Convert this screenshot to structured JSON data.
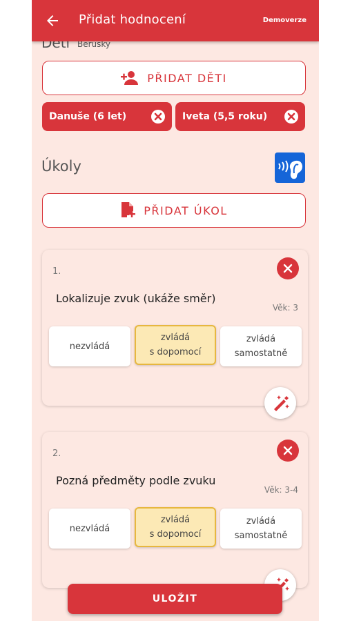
{
  "header": {
    "title": "Přidat hodnocení",
    "demo_label": "Demoverze"
  },
  "children_section": {
    "label": "Děti",
    "group": "Berušky",
    "add_button": "PŘIDAT DĚTI",
    "chips": [
      {
        "label": "Danuše (6 let)"
      },
      {
        "label": "Iveta (5,5 roku)"
      }
    ]
  },
  "tasks_section": {
    "label": "Úkoly",
    "add_button": "PŘIDAT ÚKOL"
  },
  "tasks": [
    {
      "number": "1.",
      "title": "Lokalizuje zvuk (ukáže směr)",
      "age": "Věk: 3",
      "options": [
        {
          "line1": "nezvládá",
          "line2": "",
          "selected": false
        },
        {
          "line1": "zvládá",
          "line2": "s dopomocí",
          "selected": true
        },
        {
          "line1": "zvládá",
          "line2": "samostatně",
          "selected": false
        }
      ]
    },
    {
      "number": "2.",
      "title": "Pozná předměty podle zvuku",
      "age": "Věk: 3-4",
      "options": [
        {
          "line1": "nezvládá",
          "line2": "",
          "selected": false
        },
        {
          "line1": "zvládá",
          "line2": "s dopomocí",
          "selected": true
        },
        {
          "line1": "zvládá",
          "line2": "samostatně",
          "selected": false
        }
      ]
    }
  ],
  "save_button": "ULOŽIT",
  "colors": {
    "primary": "#d8353b",
    "background": "#fde8e2",
    "selected_fill": "#fce9b5",
    "selected_border": "#e7b73f",
    "accent_blue": "#1565d8"
  }
}
